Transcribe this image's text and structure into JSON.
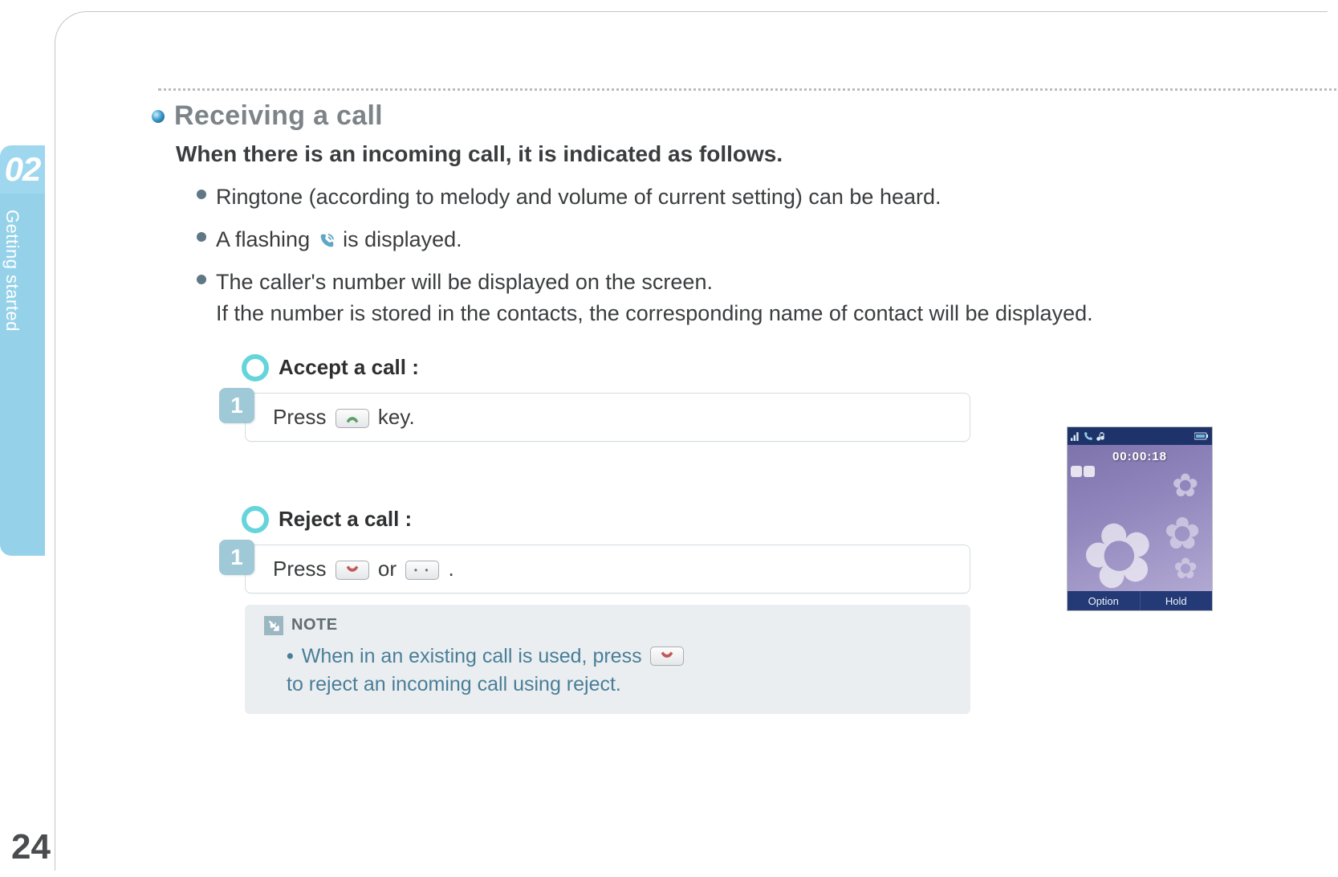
{
  "chapter": {
    "number": "02",
    "label": "Getting started"
  },
  "page_number": "24",
  "heading": "Receiving a call",
  "intro": "When there is an incoming call, it is indicated as follows.",
  "bullets": {
    "b1": "Ringtone (according to melody and volume of current setting) can be heard.",
    "b2_pre": "A flashing ",
    "b2_post": " is displayed.",
    "b3_line1": "The caller's number will be displayed on the screen.",
    "b3_line2": "If the number is stored in the contacts, the corresponding name of contact will be displayed."
  },
  "accept": {
    "title": "Accept a call :",
    "step_num": "1",
    "text_pre": "Press ",
    "text_post": " key."
  },
  "reject": {
    "title": "Reject a call :",
    "step_num": "1",
    "text_pre": "Press ",
    "text_mid": " or ",
    "text_post": " ."
  },
  "note": {
    "label": "NOTE",
    "text_pre": "When in an existing call is used, press ",
    "text_post": " to reject an incoming call using reject."
  },
  "phone": {
    "timer": "00:00:18",
    "softkeys": {
      "left": "Option",
      "right": "Hold"
    }
  }
}
